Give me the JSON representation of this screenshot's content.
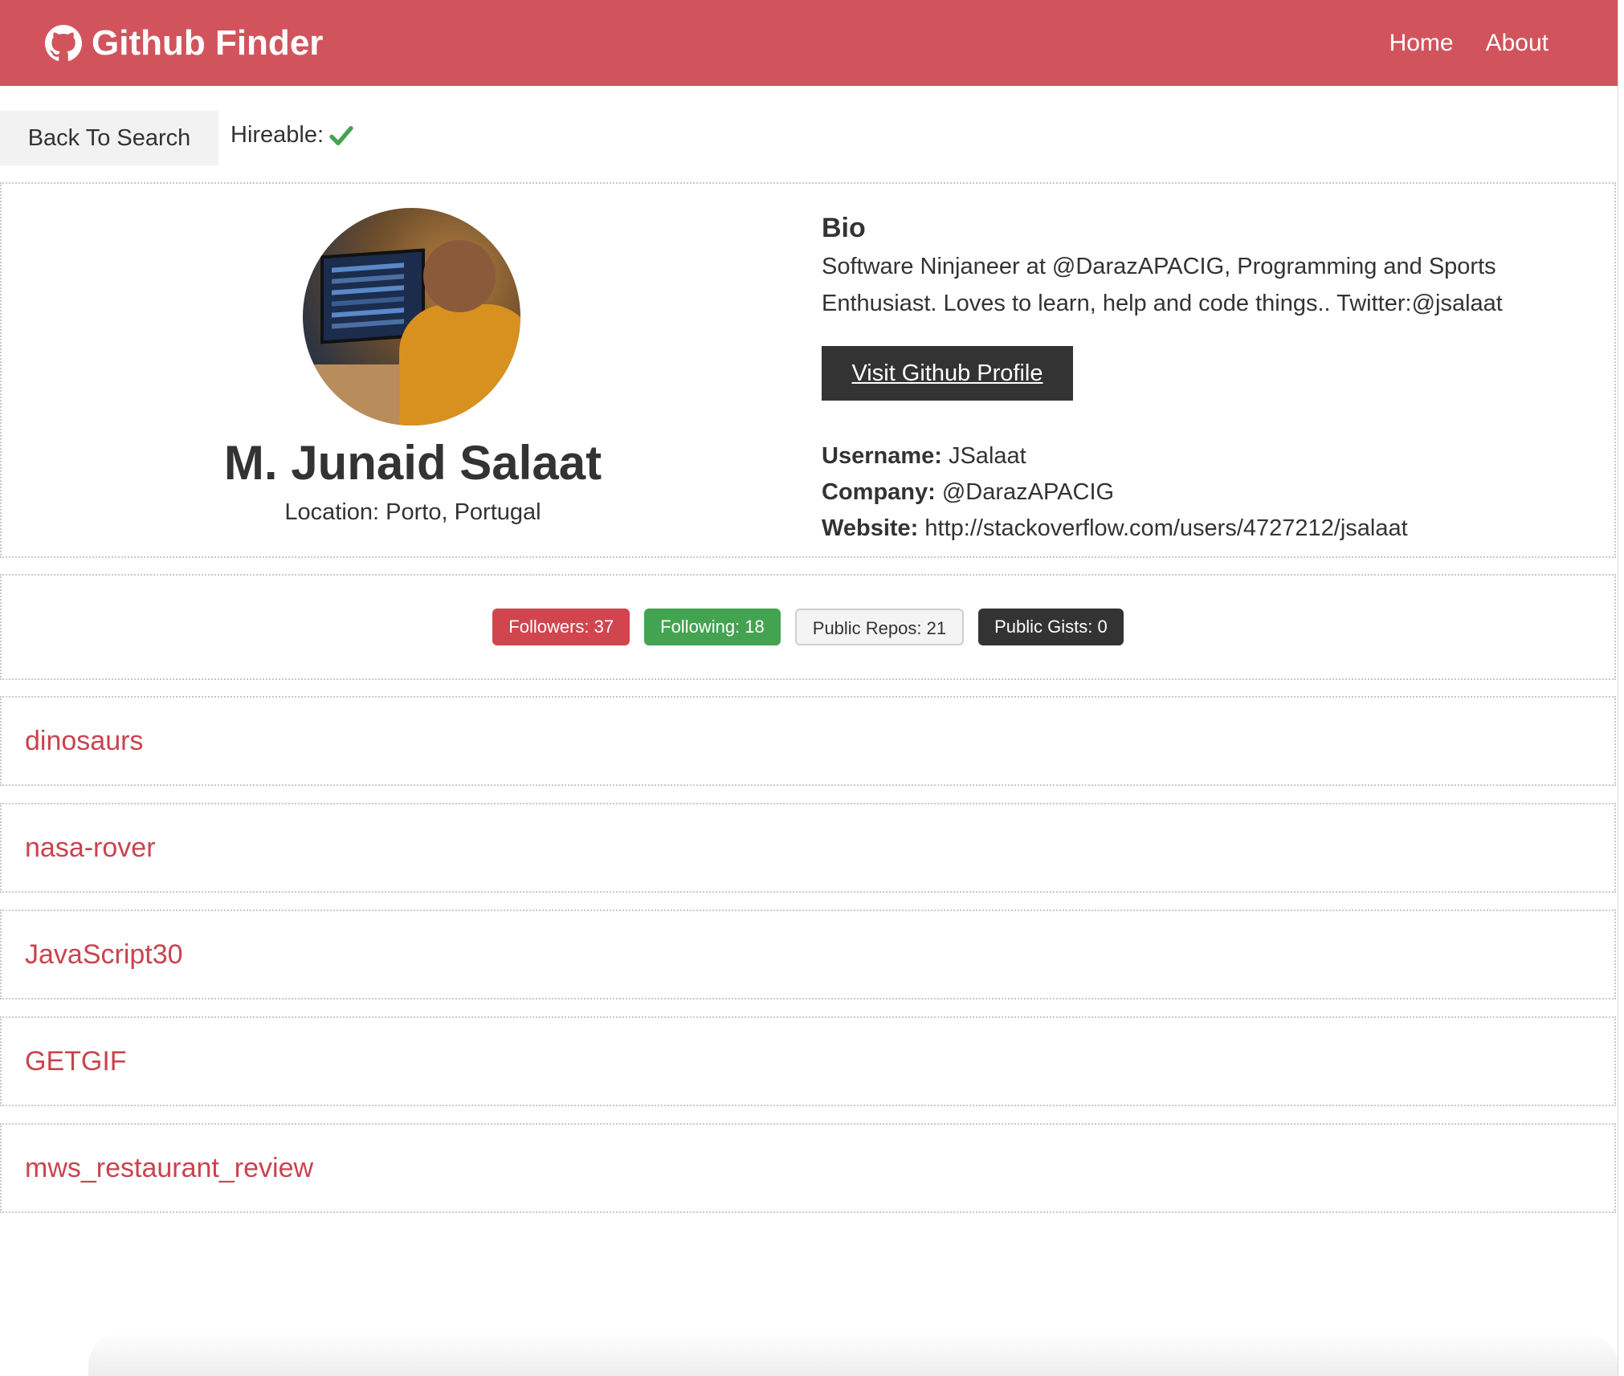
{
  "navbar": {
    "brand": "Github Finder",
    "brand_icon": "github-icon",
    "links": [
      {
        "label": "Home"
      },
      {
        "label": "About"
      }
    ],
    "bg_color": "#d1545d"
  },
  "actions": {
    "back_label": "Back To Search",
    "hireable_label": "Hireable:",
    "hireable_icon": "check-icon",
    "hireable": true
  },
  "profile": {
    "name": "M. Junaid Salaat",
    "location": "Location: Porto, Portugal",
    "bio_title": "Bio",
    "bio": "Software Ninjaneer at @DarazAPACIG, Programming and Sports Enthusiast. Loves to learn, help and code things.. Twitter:@jsalaat",
    "visit_label": "Visit Github Profile",
    "username_label": "Username:",
    "username": "JSalaat",
    "company_label": "Company:",
    "company": "@DarazAPACIG",
    "website_label": "Website:",
    "website": "http://stackoverflow.com/users/4727212/jsalaat"
  },
  "stats": {
    "followers": "Followers: 37",
    "following": "Following: 18",
    "public_repos": "Public Repos: 21",
    "public_gists": "Public Gists: 0"
  },
  "repos": [
    {
      "name": "dinosaurs"
    },
    {
      "name": "nasa-rover"
    },
    {
      "name": "JavaScript30"
    },
    {
      "name": "GETGIF"
    },
    {
      "name": "mws_restaurant_review"
    }
  ],
  "colors": {
    "accent": "#d1545d",
    "repo_link": "#c9434f",
    "success": "#44a351",
    "dark": "#333333"
  }
}
